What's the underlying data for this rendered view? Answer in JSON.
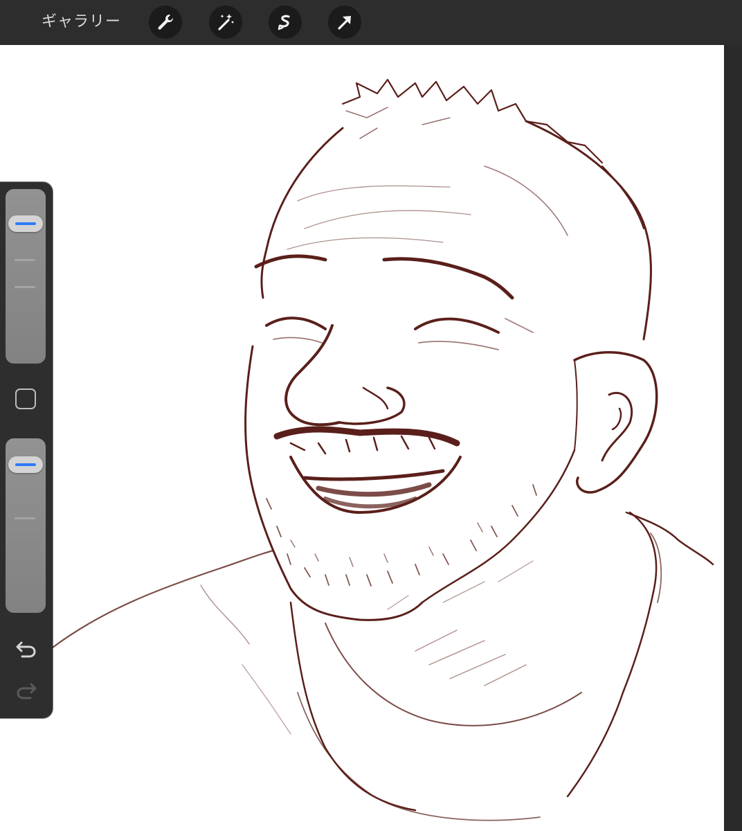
{
  "topbar": {
    "gallery_label": "ギャラリー",
    "tools": [
      {
        "icon": "wrench-icon",
        "name": "actions"
      },
      {
        "icon": "magic-wand-icon",
        "name": "adjustments"
      },
      {
        "icon": "selection-icon",
        "name": "selection"
      },
      {
        "icon": "arrow-icon",
        "name": "transform"
      }
    ]
  },
  "sidebar": {
    "brush_size_slider": {
      "level": 1.0
    },
    "opacity_slider": {
      "level": 1.0
    },
    "modify_icon": "square-icon",
    "undo_icon": "undo-icon",
    "redo_icon": "redo-icon"
  },
  "canvas": {
    "background": "#ffffff",
    "stroke_color": "#5a1f1a"
  },
  "colors": {
    "topbar": "#2d2d2d",
    "accent": "#2f7bf5"
  }
}
